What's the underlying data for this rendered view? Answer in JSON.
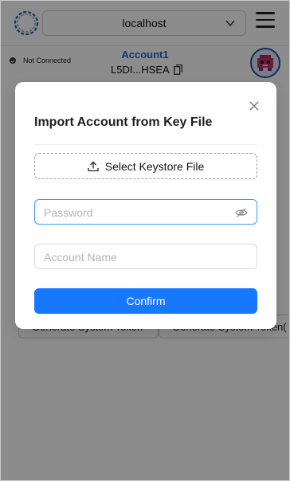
{
  "header": {
    "network": "localhost",
    "status": "Not Connected",
    "account_name": "Account1",
    "account_address": "L5DI...HSEA"
  },
  "background": {
    "buttons": [
      "Generate System Token",
      "Generate System Token("
    ]
  },
  "modal": {
    "title": "Import Account from Key File",
    "select_file_label": "Select Keystore File",
    "password_placeholder": "Password",
    "account_name_placeholder": "Account Name",
    "confirm_label": "Confirm"
  },
  "colors": {
    "primary": "#1677ff",
    "account_name": "#1668dc",
    "focus_border": "#4096ff"
  },
  "icons": [
    "logo-icon",
    "chevron-down-icon",
    "menu-icon",
    "copy-icon",
    "avatar",
    "close-icon",
    "upload-icon",
    "eye-invisible-icon"
  ]
}
